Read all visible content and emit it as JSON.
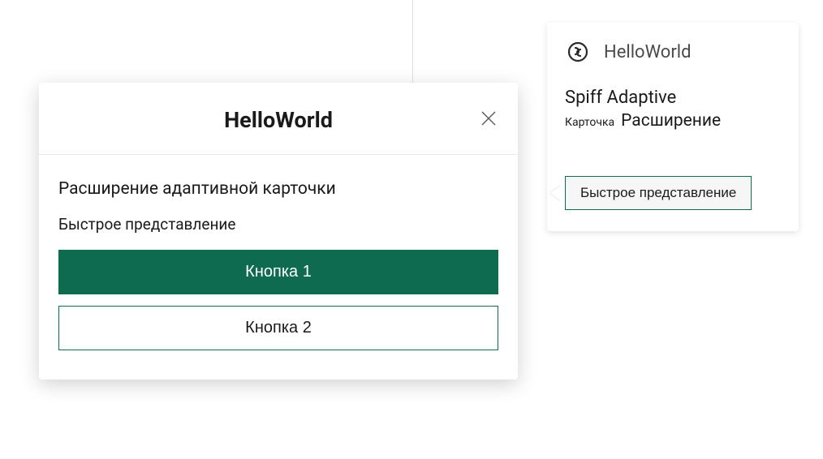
{
  "smallCard": {
    "title": "HelloWorld",
    "line1": "Spiff Adaptive",
    "line2Prefix": "Карточка",
    "line2Main": "Расширение",
    "buttonLabel": "Быстрое представление"
  },
  "modal": {
    "title": "HelloWorld",
    "text1": "Расширение адаптивной карточки",
    "text2": "Быстрое представление",
    "button1": "Кнопка 1",
    "button2": "Кнопка 2"
  },
  "colors": {
    "primary": "#0f6b4f"
  }
}
